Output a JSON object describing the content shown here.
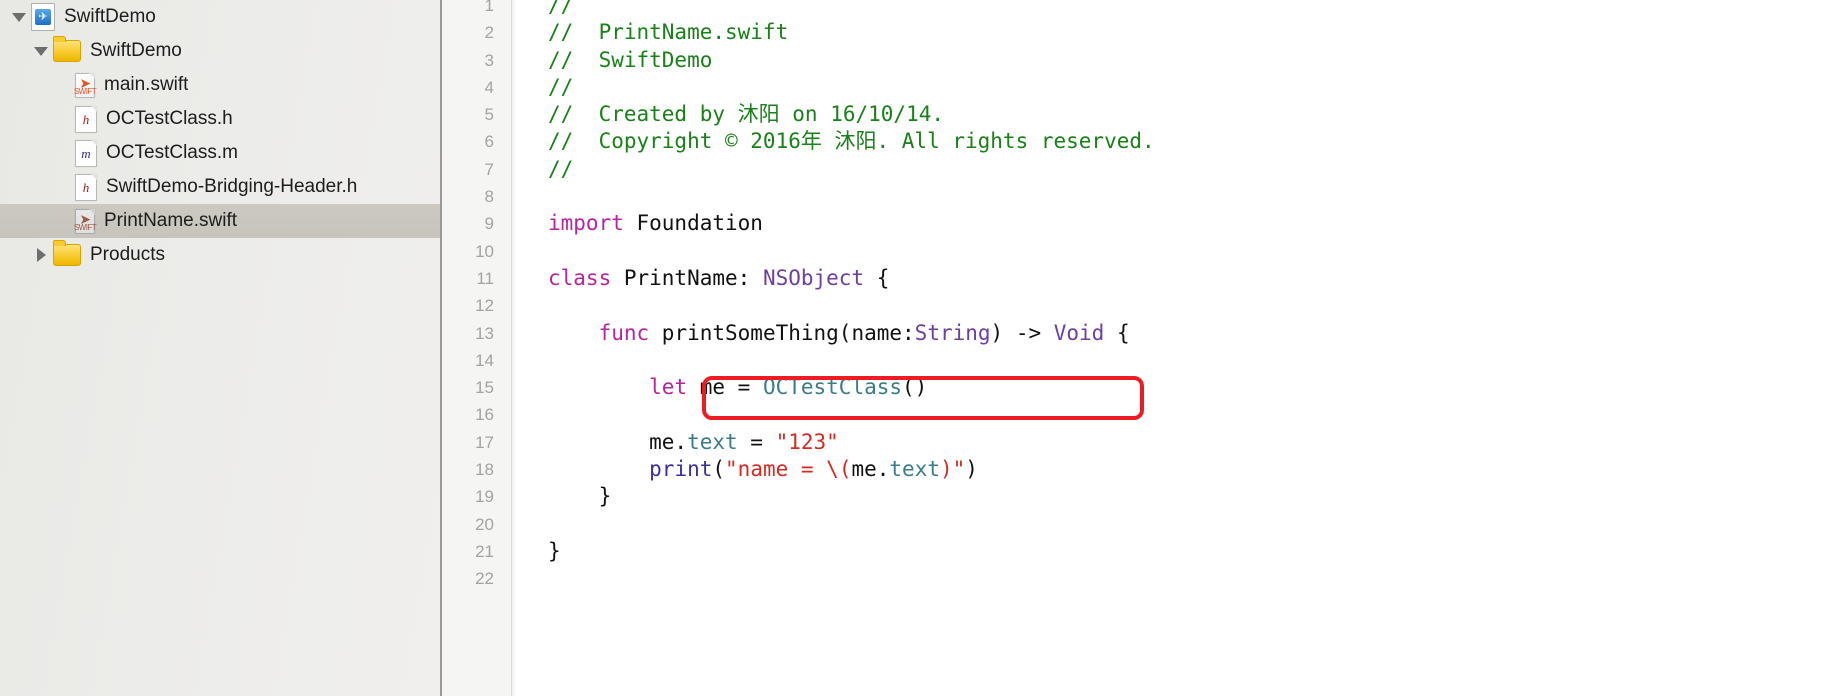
{
  "sidebar": {
    "name": "project-navigator",
    "rows": [
      {
        "label": "SwiftDemo",
        "icon": "project-icon",
        "twisty": "down",
        "indent": 0,
        "selected": false
      },
      {
        "label": "SwiftDemo",
        "icon": "folder-icon",
        "twisty": "down",
        "indent": 1,
        "selected": false
      },
      {
        "label": "main.swift",
        "icon": "swift-file-icon",
        "twisty": "none",
        "indent": 2,
        "selected": false
      },
      {
        "label": "OCTestClass.h",
        "icon": "header-file-icon",
        "twisty": "none",
        "indent": 2,
        "selected": false
      },
      {
        "label": "OCTestClass.m",
        "icon": "objc-file-icon",
        "twisty": "none",
        "indent": 2,
        "selected": false
      },
      {
        "label": "SwiftDemo-Bridging-Header.h",
        "icon": "header-file-icon",
        "twisty": "none",
        "indent": 2,
        "selected": false
      },
      {
        "label": "PrintName.swift",
        "icon": "swift-file-icon",
        "twisty": "none",
        "indent": 2,
        "selected": true
      },
      {
        "label": "Products",
        "icon": "folder-icon",
        "twisty": "right",
        "indent": 1,
        "selected": false
      }
    ]
  },
  "editor": {
    "name": "source-code-editor",
    "file": "PrintName.swift",
    "first_line": 1,
    "lines": [
      {
        "n": "1",
        "tokens": [
          {
            "t": "//",
            "c": "comment"
          }
        ]
      },
      {
        "n": "2",
        "tokens": [
          {
            "t": "//  PrintName.swift",
            "c": "comment"
          }
        ]
      },
      {
        "n": "3",
        "tokens": [
          {
            "t": "//  SwiftDemo",
            "c": "comment"
          }
        ]
      },
      {
        "n": "4",
        "tokens": [
          {
            "t": "//",
            "c": "comment"
          }
        ]
      },
      {
        "n": "5",
        "tokens": [
          {
            "t": "//  Created by 沐阳 on 16/10/14.",
            "c": "comment"
          }
        ]
      },
      {
        "n": "6",
        "tokens": [
          {
            "t": "//  Copyright © 2016年 沐阳. All rights reserved.",
            "c": "comment"
          }
        ]
      },
      {
        "n": "7",
        "tokens": [
          {
            "t": "//",
            "c": "comment"
          }
        ]
      },
      {
        "n": "8",
        "tokens": []
      },
      {
        "n": "9",
        "tokens": [
          {
            "t": "import",
            "c": "kw"
          },
          {
            "t": " Foundation",
            "c": "plain"
          }
        ]
      },
      {
        "n": "10",
        "tokens": []
      },
      {
        "n": "11",
        "tokens": [
          {
            "t": "class",
            "c": "kw"
          },
          {
            "t": " PrintName: ",
            "c": "plain"
          },
          {
            "t": "NSObject",
            "c": "type"
          },
          {
            "t": " {",
            "c": "plain"
          }
        ]
      },
      {
        "n": "12",
        "tokens": []
      },
      {
        "n": "13",
        "tokens": [
          {
            "t": "    ",
            "c": "plain"
          },
          {
            "t": "func",
            "c": "kw"
          },
          {
            "t": " printSomeThing(name:",
            "c": "plain"
          },
          {
            "t": "String",
            "c": "type"
          },
          {
            "t": ") -> ",
            "c": "plain"
          },
          {
            "t": "Void",
            "c": "type"
          },
          {
            "t": " {",
            "c": "plain"
          }
        ]
      },
      {
        "n": "14",
        "tokens": []
      },
      {
        "n": "15",
        "tokens": [
          {
            "t": "        ",
            "c": "plain"
          },
          {
            "t": "let",
            "c": "kw"
          },
          {
            "t": " me = ",
            "c": "plain"
          },
          {
            "t": "OCTestClass",
            "c": "class"
          },
          {
            "t": "()",
            "c": "plain"
          }
        ]
      },
      {
        "n": "16",
        "tokens": []
      },
      {
        "n": "17",
        "tokens": [
          {
            "t": "        me.",
            "c": "plain"
          },
          {
            "t": "text",
            "c": "class"
          },
          {
            "t": " = ",
            "c": "plain"
          },
          {
            "t": "\"123\"",
            "c": "str"
          }
        ]
      },
      {
        "n": "18",
        "tokens": [
          {
            "t": "        ",
            "c": "plain"
          },
          {
            "t": "print",
            "c": "fn"
          },
          {
            "t": "(",
            "c": "plain"
          },
          {
            "t": "\"name = \\(",
            "c": "str"
          },
          {
            "t": "me.",
            "c": "plain"
          },
          {
            "t": "text",
            "c": "class"
          },
          {
            "t": ")\"",
            "c": "str"
          },
          {
            "t": ")",
            "c": "plain"
          }
        ]
      },
      {
        "n": "19",
        "tokens": [
          {
            "t": "    }",
            "c": "plain"
          }
        ]
      },
      {
        "n": "20",
        "tokens": []
      },
      {
        "n": "21",
        "tokens": [
          {
            "t": "}",
            "c": "plain"
          }
        ]
      },
      {
        "n": "22",
        "tokens": []
      }
    ]
  },
  "annotation": {
    "name": "red-highlight-box",
    "target_line": "15",
    "color": "#ed1c24"
  },
  "colors": {
    "comment": "#1a8018",
    "keyword": "#b8249c",
    "type": "#6b3fa0",
    "string": "#d42a21",
    "class_ref": "#3a7d85",
    "function": "#3b2fa0",
    "selection": "#c8c6be",
    "annotation": "#ed1c24"
  }
}
